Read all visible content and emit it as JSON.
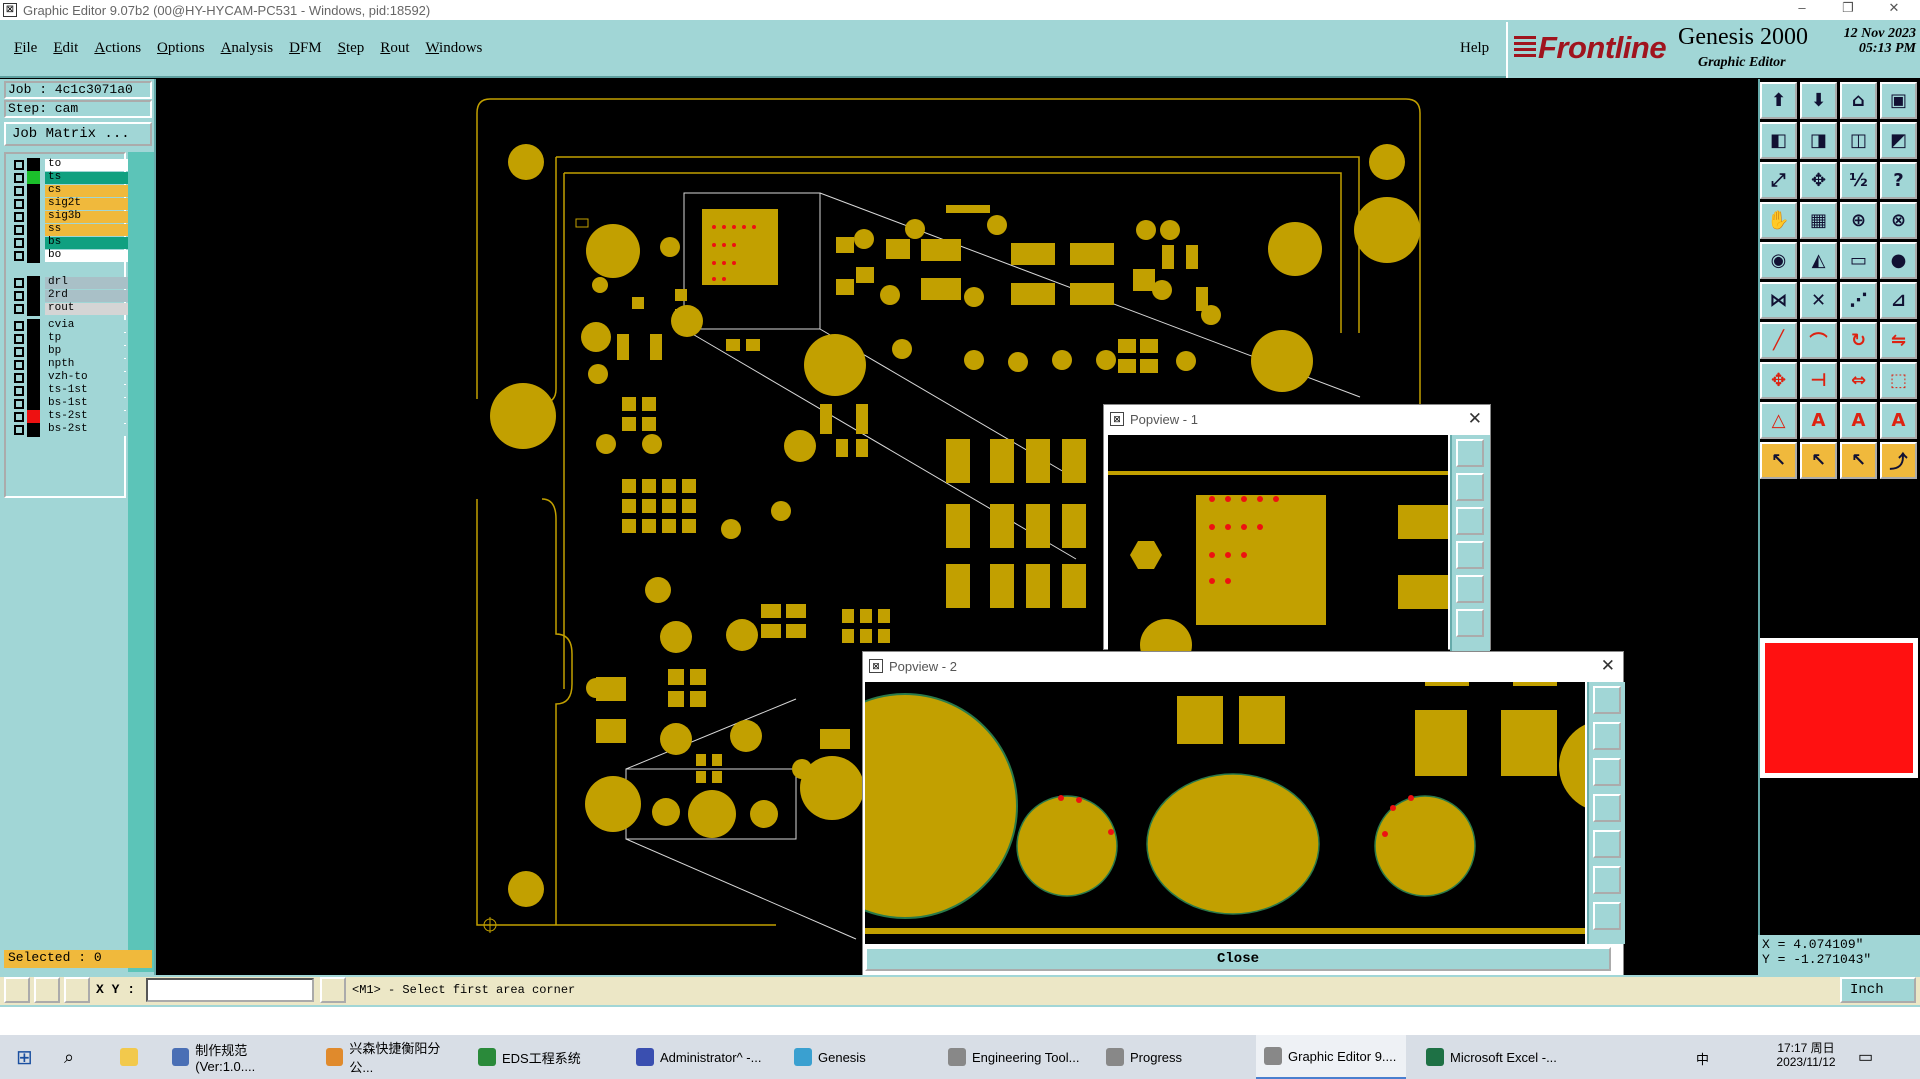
{
  "window": {
    "title": "Graphic Editor 9.07b2 (00@HY-HYCAM-PC531 - Windows, pid:18592)",
    "minimize": "–",
    "restore": "❐",
    "close": "✕"
  },
  "menu": {
    "items": [
      "File",
      "Edit",
      "Actions",
      "Options",
      "Analysis",
      "DFM",
      "Step",
      "Rout",
      "Windows"
    ],
    "help": "Help"
  },
  "brand": {
    "logo": "Frontline",
    "product": "Genesis 2000",
    "subtitle": "Graphic Editor",
    "date_line": "12 Nov 2023",
    "time_line": "05:13 PM"
  },
  "job": {
    "job_line": "Job : 4c1c3071a0",
    "step_line": "Step: cam",
    "matrix_button": "Job Matrix ..."
  },
  "layers": [
    {
      "name": "to",
      "color": "#ffffff",
      "swatch": "#000000"
    },
    {
      "name": "ts",
      "color": "#10a080",
      "swatch": "#1bbf2b"
    },
    {
      "name": "cs",
      "color": "#f0b93c",
      "swatch": "#000000"
    },
    {
      "name": "sig2t",
      "color": "#f0b93c",
      "swatch": "#000000"
    },
    {
      "name": "sig3b",
      "color": "#f0b93c",
      "swatch": "#000000"
    },
    {
      "name": "ss",
      "color": "#f0b93c",
      "swatch": "#000000"
    },
    {
      "name": "bs",
      "color": "#10a080",
      "swatch": "#000000"
    },
    {
      "name": "bo",
      "color": "#ffffff",
      "swatch": "#000000"
    },
    {
      "name": "drl",
      "color": "#a9c0c7",
      "swatch": "#000000"
    },
    {
      "name": "2rd",
      "color": "#a9c0c7",
      "swatch": "#000000"
    },
    {
      "name": "rout",
      "color": "#d5d5d5",
      "swatch": "#000000"
    },
    {
      "name": "cvia",
      "color": "#a1d6d6",
      "swatch": "#000000"
    },
    {
      "name": "tp",
      "color": "#a1d6d6",
      "swatch": "#000000"
    },
    {
      "name": "bp",
      "color": "#a1d6d6",
      "swatch": "#000000"
    },
    {
      "name": "npth",
      "color": "#a1d6d6",
      "swatch": "#000000"
    },
    {
      "name": "vzh-to",
      "color": "#a1d6d6",
      "swatch": "#000000"
    },
    {
      "name": "ts-1st",
      "color": "#a1d6d6",
      "swatch": "#000000"
    },
    {
      "name": "bs-1st",
      "color": "#a1d6d6",
      "swatch": "#000000"
    },
    {
      "name": "ts-2st",
      "color": "#a1d6d6",
      "swatch": "#ee1111"
    },
    {
      "name": "bs-2st",
      "color": "#a1d6d6",
      "swatch": "#000000"
    }
  ],
  "selected": "Selected : 0",
  "status": {
    "xy_label": "X Y :",
    "prompt": "<M1> - Select first area corner",
    "unit": "Inch"
  },
  "coords": {
    "x": "X = 4.074109\"",
    "y": "Y = -1.271043\""
  },
  "popview1": {
    "title": "Popview - 1"
  },
  "popview2": {
    "title": "Popview - 2",
    "close_label": "Close"
  },
  "tools": [
    "zoom-home-icon",
    "zoom-in-icon",
    "home-icon",
    "window-icon",
    "pan-left-icon",
    "pan-right-icon",
    "pan-up-icon",
    "pan-down-icon",
    "fit-icon",
    "center-icon",
    "scale-1-2-icon",
    "help-icon",
    "hand-icon",
    "grid-icon",
    "snap-icon",
    "snap2-icon",
    "measure-icon",
    "profile-icon",
    "ruler-icon",
    "dot-icon",
    "connect-icon",
    "intersect-icon",
    "midpoint-icon",
    "edge-icon",
    "line-icon",
    "arc-icon",
    "rotate-icon",
    "mirror-icon",
    "move-icon",
    "split-icon",
    "stretch-icon",
    "group-icon",
    "poly-icon",
    "text-a-icon",
    "text-b-icon",
    "text-c-icon",
    "pointer-icon",
    "pointer2-icon",
    "pointer3-icon",
    "route-icon"
  ],
  "taskbar": {
    "items": [
      "制作规范 (Ver:1.0....",
      "兴森快捷衡阳分公...",
      "EDS工程系统",
      "Administrator^ -...",
      "Genesis",
      "Engineering Tool...",
      "Progress",
      "Graphic Editor 9....",
      "Microsoft Excel -..."
    ],
    "time": "17:17 周日",
    "date": "2023/11/12",
    "ime": "中"
  },
  "colors": {
    "pad": "#c2a000",
    "outline": "#c2a000",
    "red_dot": "#ee1111",
    "ui_teal": "#a1d6d6"
  }
}
